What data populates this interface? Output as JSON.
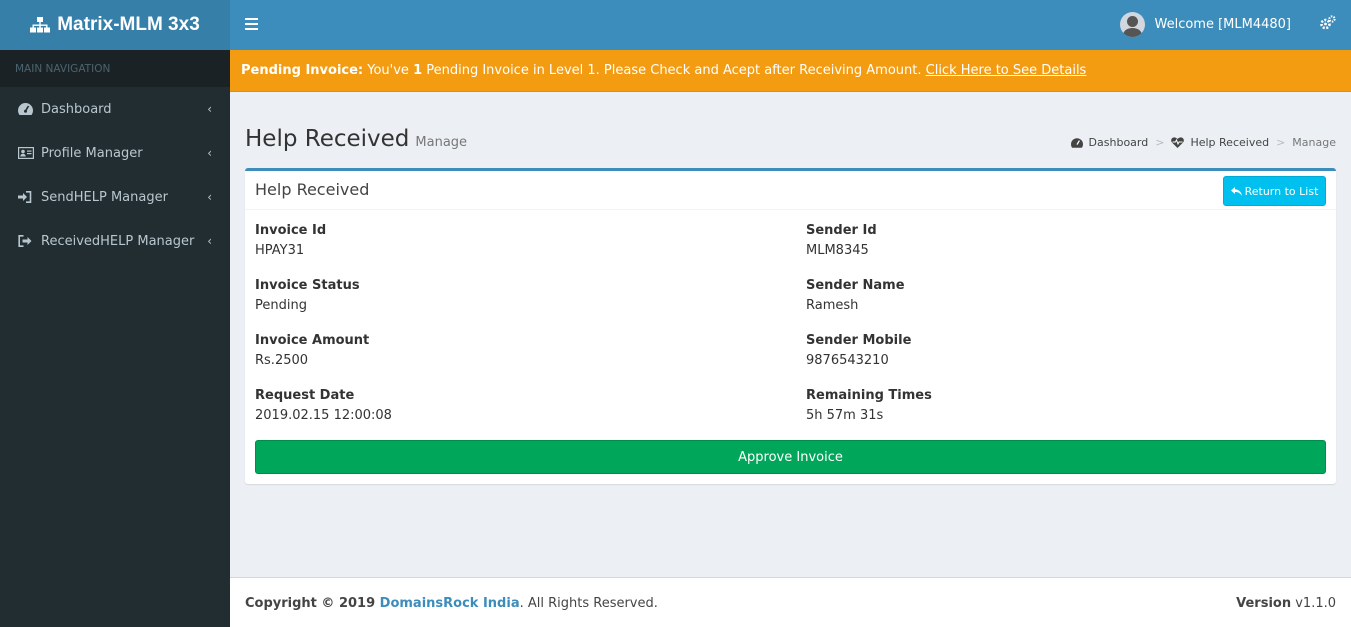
{
  "app": {
    "logo_text": "Matrix-MLM 3x3"
  },
  "topbar": {
    "welcome": "Welcome [MLM4480]"
  },
  "sidebar": {
    "header": "MAIN NAVIGATION",
    "items": [
      {
        "label": "Dashboard",
        "icon": "dashboard-icon"
      },
      {
        "label": "Profile Manager",
        "icon": "id-card-icon"
      },
      {
        "label": "SendHELP Manager",
        "icon": "sign-in-icon"
      },
      {
        "label": "ReceivedHELP Manager",
        "icon": "sign-out-icon"
      }
    ]
  },
  "alert": {
    "title": "Pending Invoice:",
    "text_before": " You've ",
    "count": "1",
    "text_after": " Pending Invoice in Level 1. Please Check and Acept after Receiving Amount. ",
    "link": "Click Here to See Details",
    "color": "#f39c12"
  },
  "page": {
    "title": "Help Received",
    "subtitle": "Manage",
    "breadcrumb": [
      "Dashboard",
      "Help Received",
      "Manage"
    ]
  },
  "box": {
    "title": "Help Received",
    "return_label": "Return to List",
    "fields": [
      {
        "label": "Invoice Id",
        "value": "HPAY31"
      },
      {
        "label": "Sender Id",
        "value": "MLM8345"
      },
      {
        "label": "Invoice Status",
        "value": "Pending"
      },
      {
        "label": "Sender Name",
        "value": "Ramesh"
      },
      {
        "label": "Invoice Amount",
        "value": "Rs.2500"
      },
      {
        "label": "Sender Mobile",
        "value": "9876543210"
      },
      {
        "label": "Request Date",
        "value": "2019.02.15 12:00:08"
      },
      {
        "label": "Remaining Times",
        "value": "5h 57m 31s"
      }
    ],
    "approve_label": "Approve Invoice"
  },
  "footer": {
    "copyright": "Copyright © 2019 ",
    "company": "DomainsRock India",
    "rights": ". All Rights Reserved.",
    "version_label": "Version",
    "version": " v1.1.0"
  },
  "colors": {
    "primary": "#3c8dbc",
    "sidebar": "#222d32",
    "success": "#00a65a",
    "info": "#00c0ef"
  }
}
